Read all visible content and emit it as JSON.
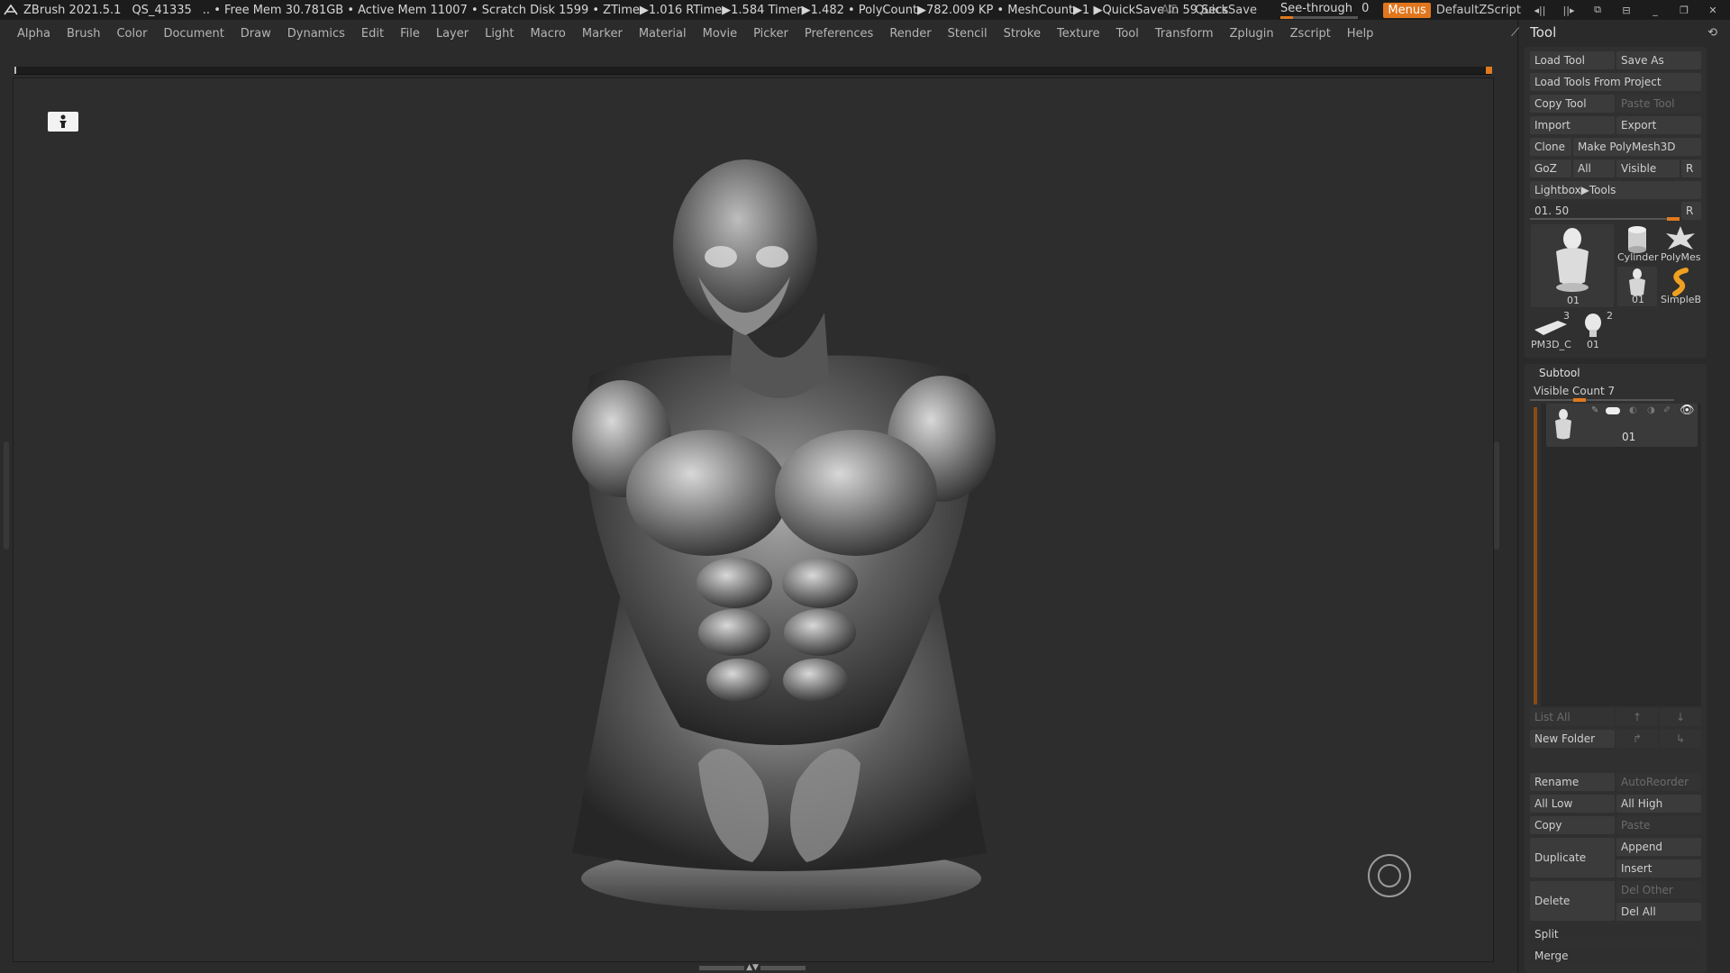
{
  "titlebar": {
    "app": "ZBrush 2021.5.1",
    "session": "QS_41335",
    "status": ".. • Free Mem 30.781GB • Active Mem 11007 • Scratch Disk 1599 •  ZTime▶1.016 RTime▶1.584 Timer▶1.482 • PolyCount▶782.009 KP  • MeshCount▶1  ▶QuickSave In 59 Secs",
    "ac": "AC",
    "quicksave": "QuickSave",
    "seethrough_label": "See-through",
    "seethrough_value": "0",
    "menus": "Menus",
    "script": "DefaultZScript"
  },
  "menubar": [
    "Alpha",
    "Brush",
    "Color",
    "Document",
    "Draw",
    "Dynamics",
    "Edit",
    "File",
    "Layer",
    "Light",
    "Macro",
    "Marker",
    "Material",
    "Movie",
    "Picker",
    "Preferences",
    "Render",
    "Stencil",
    "Stroke",
    "Texture",
    "Tool",
    "Transform",
    "Zplugin",
    "Zscript",
    "Help"
  ],
  "tool_panel": {
    "title": "Tool",
    "load_tool": "Load Tool",
    "save_as": "Save As",
    "load_from_project": "Load Tools From Project",
    "copy_tool": "Copy Tool",
    "paste_tool": "Paste Tool",
    "import": "Import",
    "export": "Export",
    "clone": "Clone",
    "make_polymesh": "Make PolyMesh3D",
    "goz": "GoZ",
    "all": "All",
    "visible": "Visible",
    "r": "R",
    "lightbox_tools": "Lightbox▶Tools",
    "slider_value": "01. 50",
    "thumbs": {
      "main": "01",
      "cylinder": "Cylinder",
      "polymesh": "PolyMes",
      "small01": "01",
      "simpleb": "SimpleB",
      "pm3d": "PM3D_C",
      "pm3d_count": "3",
      "head01": "01",
      "head_count": "2"
    }
  },
  "subtool": {
    "title": "Subtool",
    "visible_count": "Visible Count 7",
    "item_name": "01",
    "list_all": "List All",
    "new_folder": "New Folder",
    "rename": "Rename",
    "auto_reorder": "AutoReorder",
    "all_low": "All Low",
    "all_high": "All High",
    "copy": "Copy",
    "paste": "Paste",
    "duplicate": "Duplicate",
    "append": "Append",
    "insert": "Insert",
    "delete": "Delete",
    "del_other": "Del Other",
    "del_all": "Del All",
    "split": "Split",
    "merge": "Merge"
  },
  "colors": {
    "accent": "#e07a1f",
    "bg": "#2b2b2b",
    "panel": "#2a2a2a"
  }
}
